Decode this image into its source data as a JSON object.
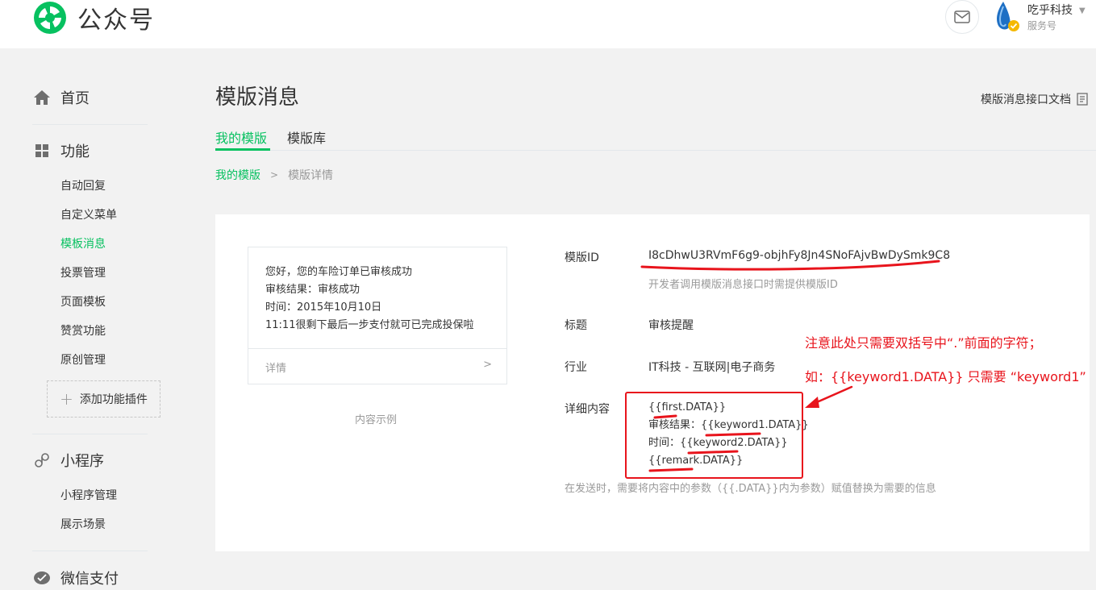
{
  "header": {
    "logo_text": "公众号",
    "account_name": "吃乎科技",
    "account_type": "服务号",
    "colors": {
      "brand": "#07c160",
      "annotation": "#e8141c"
    }
  },
  "sidebar": {
    "sections": [
      {
        "label": "首页",
        "icon": "home-icon"
      },
      {
        "label": "功能",
        "icon": "grid-icon"
      },
      {
        "label": "小程序",
        "icon": "link-icon"
      },
      {
        "label": "微信支付",
        "icon": "wechat-pay-icon"
      }
    ],
    "function_items": [
      "自动回复",
      "自定义菜单",
      "模板消息",
      "投票管理",
      "页面模板",
      "赞赏功能",
      "原创管理"
    ],
    "add_plugin_label": "添加功能插件",
    "miniprogram_items": [
      "小程序管理",
      "展示场景"
    ]
  },
  "main": {
    "title": "模版消息",
    "doc_link": "模版消息接口文档",
    "tabs": [
      "我的模版",
      "模版库"
    ],
    "breadcrumb": {
      "parent": "我的模版",
      "current": "模版详情"
    }
  },
  "preview": {
    "lines": [
      "您好，您的车险订单已审核成功",
      "审核结果：审核成功",
      "时间：2015年10月10日",
      "11:11很剩下最后一步支付就可已完成投保啦"
    ],
    "detail_label": "详情",
    "caption": "内容示例"
  },
  "detail": {
    "id_label": "模版ID",
    "id_value": "I8cDhwU3RVmF6g9-objhFy8Jn4SNoFAjvBwDySmk9C8",
    "id_hint": "开发者调用模版消息接口时需提供模版ID",
    "title_label": "标题",
    "title_value": "审核提醒",
    "industry_label": "行业",
    "industry_value": "IT科技 - 互联网|电子商务",
    "content_label": "详细内容",
    "content_lines": [
      "{{first.DATA}}",
      "审核结果：{{keyword1.DATA}}",
      "时间：{{keyword2.DATA}}",
      "{{remark.DATA}}"
    ],
    "send_hint": "在发送时，需要将内容中的参数（{{.DATA}}内为参数）赋值替换为需要的信息"
  },
  "annotations": {
    "note1": "注意此处只需要双括号中“.”前面的字符；",
    "note2": "如：{{keyword1.DATA}} 只需要 “keyword1”"
  }
}
